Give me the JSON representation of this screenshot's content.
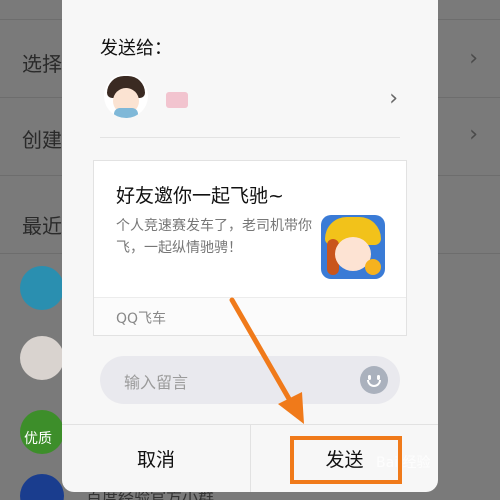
{
  "background": {
    "rows": [
      "选择",
      "创建",
      "最近"
    ],
    "partial_item_label": "优质",
    "bottom_partial_text": "百度经验官方小群"
  },
  "dialog": {
    "send_to_label": "发送给：",
    "card": {
      "title": "好友邀你一起飞驰~",
      "description": "个人竞速赛发车了，老司机带你飞，一起纵情驰骋！",
      "source": "QQ飞车"
    },
    "message_placeholder": "输入留言",
    "cancel_label": "取消",
    "send_label": "发送"
  },
  "watermark": "Bai 经验",
  "colors": {
    "accent": "#f07a1a",
    "dialog_bg": "#f7f7f7",
    "overlay_bg": "#7a7a7a"
  },
  "icons": [
    "chevron-right-icon",
    "emoji-icon",
    "avatar",
    "game-icon"
  ]
}
